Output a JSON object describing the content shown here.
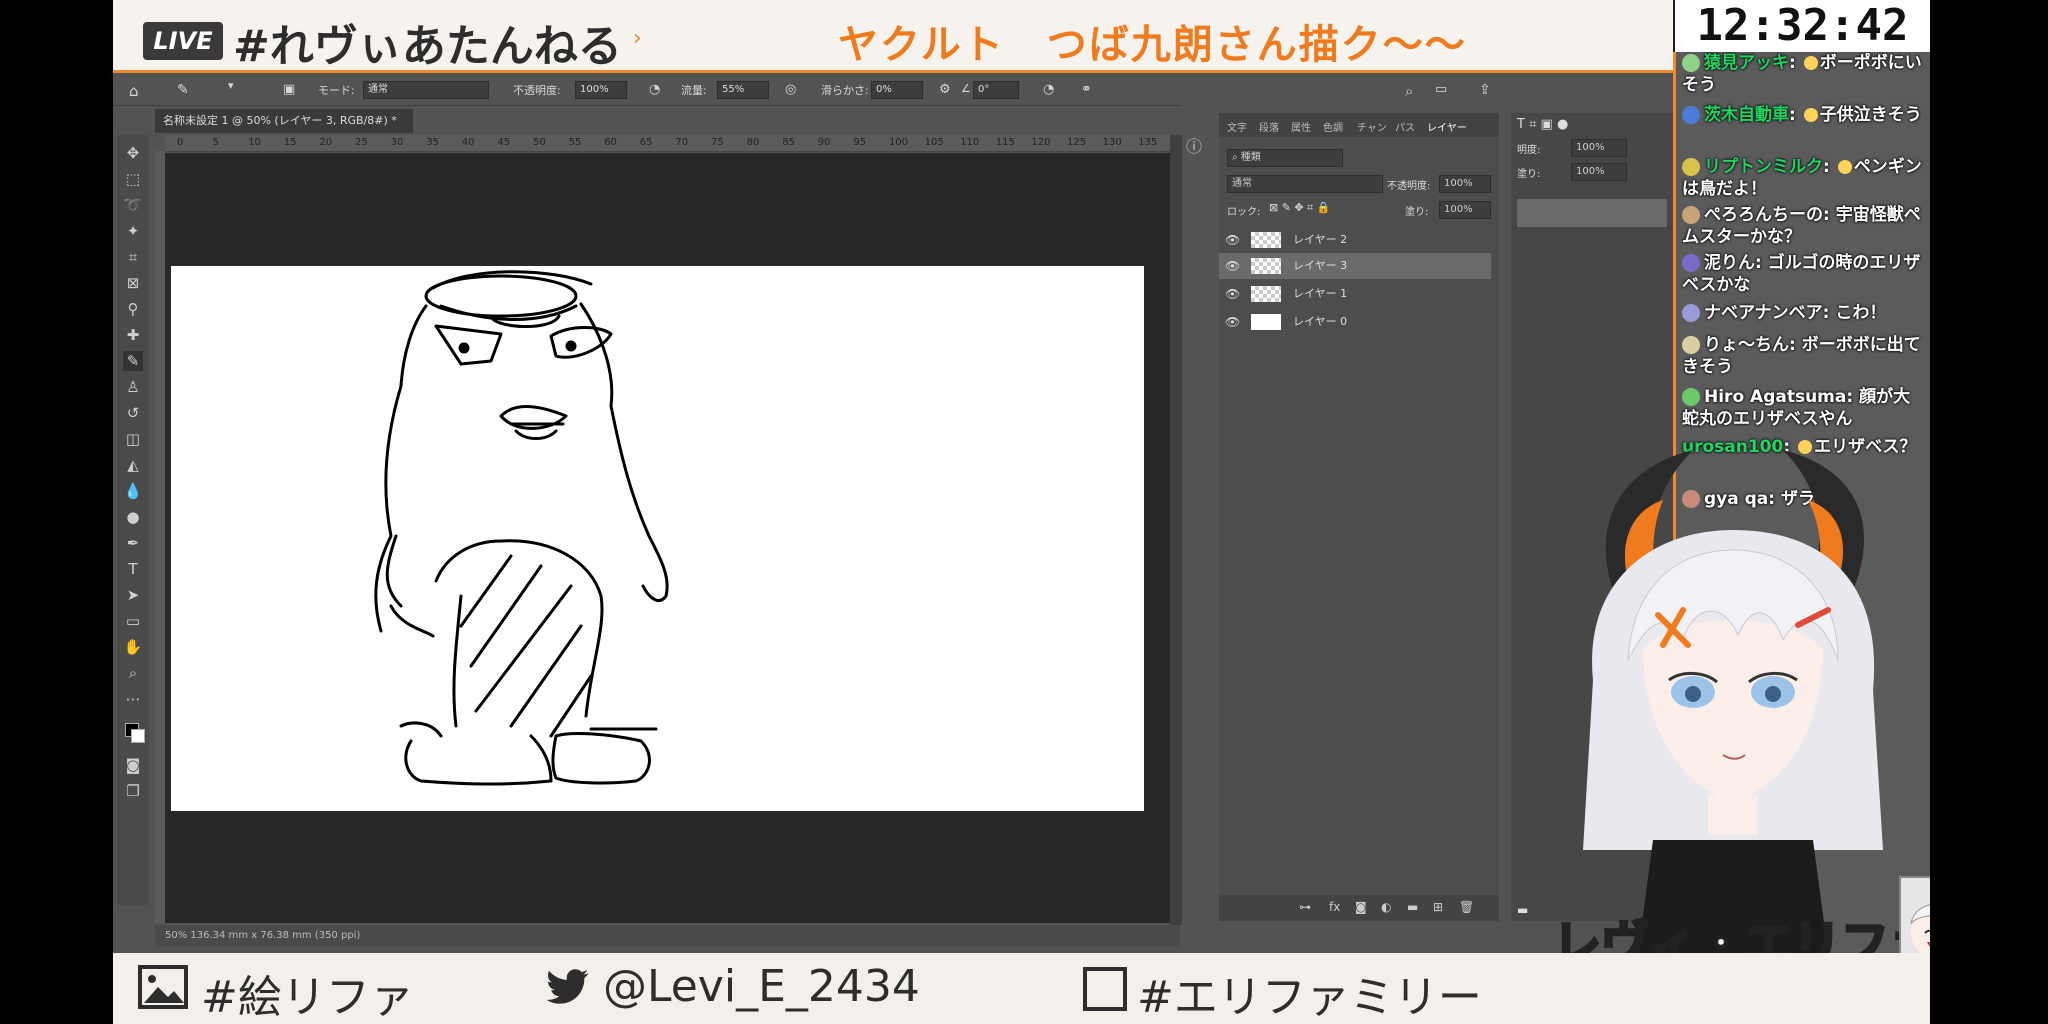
{
  "stream": {
    "live_badge": "LIVE",
    "channel_tag": "#れヴぃあたんねる",
    "topic": "ヤクルト　つば九朗さん描ク〜〜",
    "clock": "12:32:42"
  },
  "photoshop": {
    "options": {
      "mode_label": "モード:",
      "mode_value": "通常",
      "opacity_label": "不透明度:",
      "opacity_value": "100%",
      "flow_label": "流量:",
      "flow_value": "55%",
      "smoothing_label": "滑らかさ:",
      "smoothing_value": "0%",
      "angle_value": "0°"
    },
    "document_tab": "名称未設定 1 @ 50% (レイヤー 3, RGB/8#) *",
    "ruler_ticks": [
      "0",
      "5",
      "10",
      "15",
      "20",
      "25",
      "30",
      "35",
      "40",
      "45",
      "50",
      "55",
      "60",
      "65",
      "70",
      "75",
      "80",
      "85",
      "90",
      "95",
      "100",
      "105",
      "110",
      "115",
      "120",
      "125",
      "130",
      "135"
    ],
    "status_bar": "50%    136.34 mm x 76.38 mm (350 ppi)",
    "panel_tabs": [
      "文字",
      "段落",
      "属性",
      "色調",
      "チャン",
      "パス",
      "レイヤー"
    ],
    "layers_panel": {
      "filter_label": "種類",
      "blend_mode": "通常",
      "opacity_label": "不透明度:",
      "opacity_value": "100%",
      "lock_label": "ロック:",
      "fill_label": "塗り:",
      "fill_value": "100%",
      "layers": [
        {
          "name": "レイヤー 2",
          "selected": false,
          "thumb": "transparent"
        },
        {
          "name": "レイヤー 3",
          "selected": true,
          "thumb": "transparent"
        },
        {
          "name": "レイヤー 1",
          "selected": false,
          "thumb": "transparent"
        },
        {
          "name": "レイヤー 0",
          "selected": false,
          "thumb": "white"
        }
      ]
    },
    "right_panel": {
      "opacity_label": "明度:",
      "opacity_value": "100%",
      "fill_label": "塗り:",
      "fill_value": "100%"
    }
  },
  "bottom_bar": {
    "art_tag": "#絵リファ",
    "twitter": "@Levi_E_2434",
    "family_tag": "#エリファミリー"
  },
  "chat": [
    {
      "author": "猿見アッキ",
      "text": "ボーポボにいそう",
      "member": true
    },
    {
      "author": "茨木自動車",
      "text": "子供泣きそう",
      "member": true
    },
    {
      "author": "リプトンミルク",
      "text": "ペンギンは鳥だよ！",
      "member": true
    },
    {
      "author": "ぺろろんちーの",
      "text": "宇宙怪獣ペムスターかな？",
      "member": false
    },
    {
      "author": "泥りん",
      "text": "ゴルゴの時のエリザベスかな",
      "member": false
    },
    {
      "author": "ナベアナンベア",
      "text": "こわ！",
      "member": false
    },
    {
      "author": "りょ〜ちん",
      "text": "ボーボボに出てきそう",
      "member": false
    },
    {
      "author": "Hiro Agatsuma",
      "text": "顔が大蛇丸のエリザベスやん",
      "member": false
    },
    {
      "author": "urosan100",
      "text": "エリザベス？",
      "member": true
    },
    {
      "author": "gya qa",
      "text": "ザラ",
      "member": false
    }
  ],
  "logo_text": "レヴィ・エリファ",
  "colors": {
    "accent": "#f08a2a",
    "member_name": "#1ed760"
  }
}
